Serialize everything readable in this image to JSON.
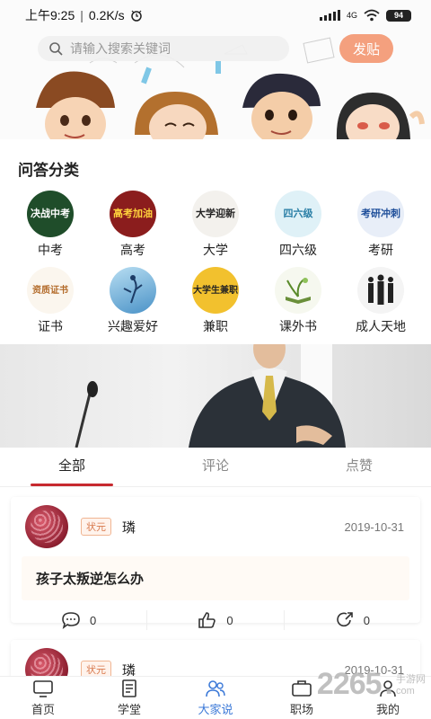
{
  "status_bar": {
    "time": "上午9:25",
    "speed": "0.2K/s",
    "network": "4G",
    "battery": "94"
  },
  "header": {
    "search_placeholder": "请输入搜索关键词",
    "post_button": "发贴"
  },
  "categories": {
    "title": "问答分类",
    "items": [
      {
        "label": "中考",
        "icon_text": "决战中考"
      },
      {
        "label": "高考",
        "icon_text": "高考加油"
      },
      {
        "label": "大学",
        "icon_text": "大学迎新"
      },
      {
        "label": "四六级",
        "icon_text": "四六级"
      },
      {
        "label": "考研",
        "icon_text": "考研冲刺"
      },
      {
        "label": "证书",
        "icon_text": "资质证书"
      },
      {
        "label": "兴趣爱好",
        "icon_text": ""
      },
      {
        "label": "兼职",
        "icon_text": "大学生兼职"
      },
      {
        "label": "课外书",
        "icon_text": ""
      },
      {
        "label": "成人天地",
        "icon_text": ""
      }
    ]
  },
  "tabs": [
    "全部",
    "评论",
    "点赞"
  ],
  "posts": [
    {
      "rank": "状元",
      "user": "璘",
      "date": "2019-10-31",
      "content": "孩子太叛逆怎么办",
      "comments": "0",
      "likes": "0",
      "shares": "0"
    },
    {
      "rank": "状元",
      "user": "璘",
      "date": "2019-10-31"
    }
  ],
  "bottom_nav": [
    {
      "label": "首页",
      "icon": "tv-icon"
    },
    {
      "label": "学堂",
      "icon": "notebook-icon"
    },
    {
      "label": "大家说",
      "icon": "people-icon"
    },
    {
      "label": "职场",
      "icon": "briefcase-icon"
    },
    {
      "label": "我的",
      "icon": "user-icon"
    }
  ],
  "watermark": {
    "brand": "2265",
    "dot": ".",
    "sub": "手游网",
    "suffix": "com"
  },
  "colors": {
    "accent": "#c7292f",
    "post_button": "#f4a07e",
    "nav_active": "#3d7ad8",
    "badge": "#d8794d"
  }
}
